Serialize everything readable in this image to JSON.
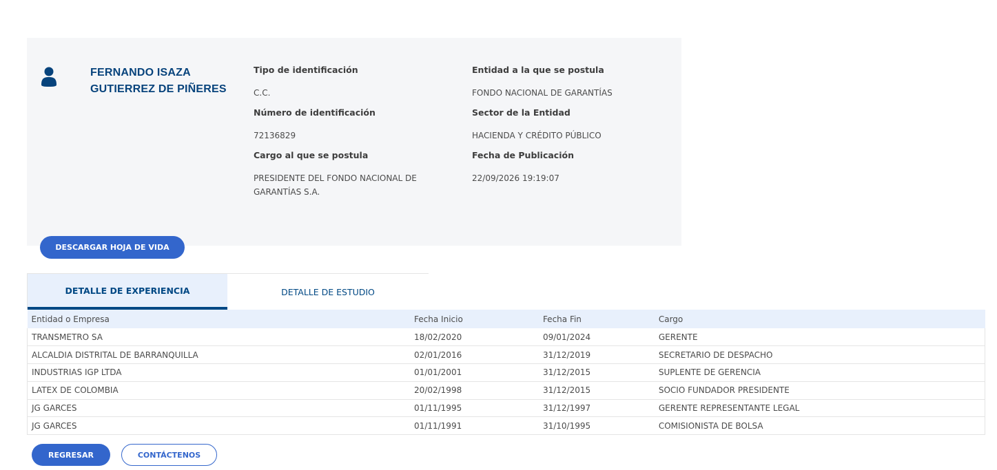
{
  "candidate": {
    "name": "FERNANDO ISAZA GUTIERREZ DE PIÑERES",
    "icon": "user-icon",
    "accent_color": "#07437c"
  },
  "fields": {
    "id_type_label": "Tipo de identificación",
    "id_type_value": "C.C.",
    "id_number_label": "Número de identificación",
    "id_number_value": "72136829",
    "position_label": "Cargo al que se postula",
    "position_value": "PRESIDENTE DEL FONDO NACIONAL DE GARANTÍAS S.A.",
    "entity_label": "Entidad a la que se postula",
    "entity_value": "FONDO NACIONAL DE GARANTÍAS",
    "sector_label": "Sector de la Entidad",
    "sector_value": "HACIENDA Y CRÉDITO PÚBLICO",
    "pub_date_label": "Fecha de Publicación",
    "pub_date_value": "22/09/2026 19:19:07"
  },
  "actions": {
    "download_cv": "DESCARGAR HOJA DE VIDA",
    "back": "REGRESAR",
    "contact": "CONTÁCTENOS",
    "primary_color": "#3366cc"
  },
  "tabs": {
    "experience": "DETALLE DE EXPERIENCIA",
    "study": "DETALLE DE ESTUDIO",
    "active": "experience"
  },
  "table": {
    "headers": {
      "entity": "Entidad o Empresa",
      "start": "Fecha Inicio",
      "end": "Fecha Fin",
      "role": "Cargo"
    },
    "rows": [
      {
        "entity": "TRANSMETRO SA",
        "start": "18/02/2020",
        "end": "09/01/2024",
        "role": "GERENTE"
      },
      {
        "entity": "ALCALDIA DISTRITAL DE BARRANQUILLA",
        "start": "02/01/2016",
        "end": "31/12/2019",
        "role": "SECRETARIO DE DESPACHO"
      },
      {
        "entity": "INDUSTRIAS IGP LTDA",
        "start": "01/01/2001",
        "end": "31/12/2015",
        "role": "SUPLENTE DE GERENCIA"
      },
      {
        "entity": "LATEX DE COLOMBIA",
        "start": "20/02/1998",
        "end": "31/12/2015",
        "role": "SOCIO FUNDADOR PRESIDENTE"
      },
      {
        "entity": "JG GARCES",
        "start": "01/11/1995",
        "end": "31/12/1997",
        "role": "GERENTE REPRESENTANTE LEGAL"
      },
      {
        "entity": "JG GARCES",
        "start": "01/11/1991",
        "end": "31/10/1995",
        "role": "COMISIONISTA DE BOLSA"
      }
    ]
  }
}
